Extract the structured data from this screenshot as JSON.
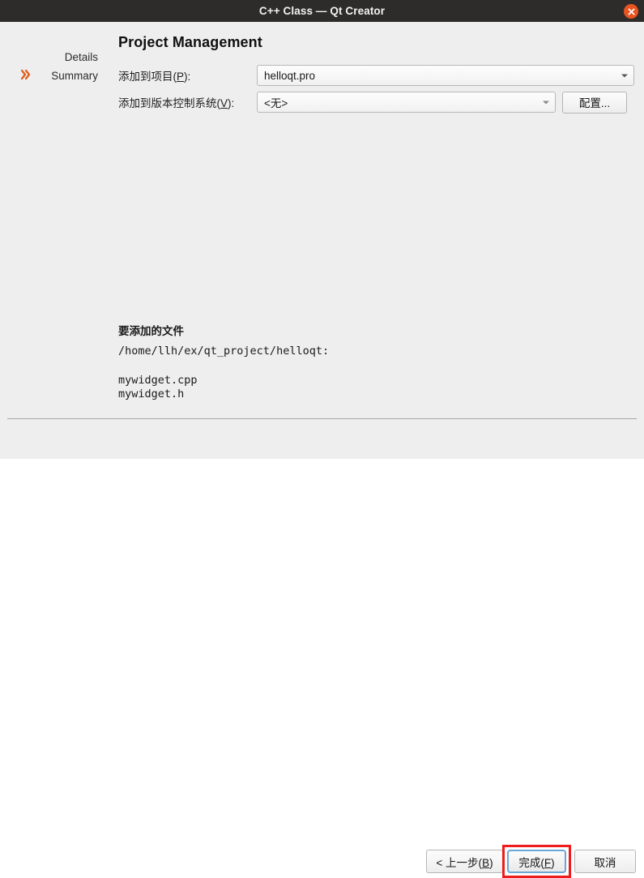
{
  "window": {
    "title": "C++ Class — Qt Creator",
    "close_icon": "close-icon",
    "accent_color": "#e95420",
    "titlebar_color": "#2e2c2b",
    "background_color": "#efeeee"
  },
  "sidebar": {
    "items": [
      {
        "label": "Details",
        "active": false
      },
      {
        "label": "Summary",
        "active": true
      }
    ],
    "active_marker_icon": "double-chevron-right-icon",
    "active_marker_color": "#e06020"
  },
  "main": {
    "page_title": "Project Management",
    "fields": [
      {
        "label_prefix": "添加到项目(",
        "label_accel": "P",
        "label_suffix": "):",
        "value": "helloqt.pro",
        "arrow_icon": "chevron-down-icon"
      },
      {
        "label_prefix": "添加到版本控制系统(",
        "label_accel": "V",
        "label_suffix": "):",
        "value": "<无>",
        "arrow_icon": "chevron-down-icon"
      }
    ],
    "configure_button": {
      "label": "配置..."
    },
    "summary": {
      "heading": "要添加的文件",
      "path": "/home/llh/ex/qt_project/helloqt:",
      "files": [
        "mywidget.cpp",
        "mywidget.h"
      ]
    }
  },
  "footer": {
    "back_button": {
      "prefix": "< 上一步(",
      "accel": "B",
      "suffix": ")"
    },
    "finish_button": {
      "prefix": "完成(",
      "accel": "F",
      "suffix": ")",
      "focused": true
    },
    "cancel_button": {
      "label": "取消"
    },
    "annotation_color": "#ee1c1c"
  }
}
